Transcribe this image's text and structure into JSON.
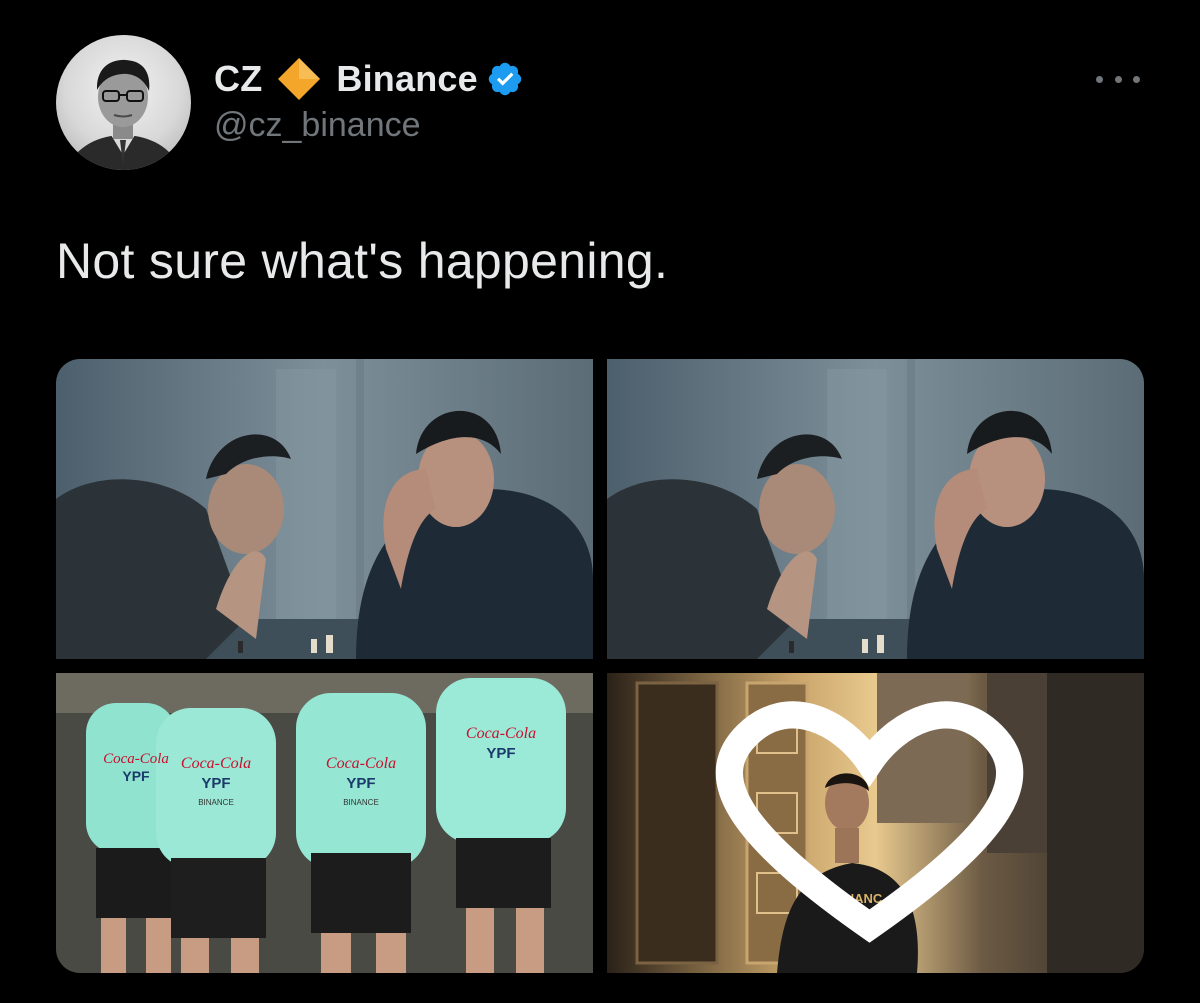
{
  "author": {
    "name_part1": "CZ",
    "name_part2": "Binance",
    "handle": "@cz_binance",
    "avatar_icon": "avatar-photo",
    "name_emoji": "orange-diamond-icon",
    "verified_icon": "verified-badge-icon"
  },
  "tweet": {
    "text": "Not sure what's happening."
  },
  "menu": {
    "more_icon": "more-options-icon"
  },
  "media": {
    "images": [
      {
        "description_icon": "chess-match-image"
      },
      {
        "description_icon": "chess-match-image"
      },
      {
        "description_icon": "team-training-image"
      },
      {
        "description_icon": "player-in-doorway-image"
      }
    ],
    "jersey_sponsor_1": "Coca-Cola",
    "jersey_sponsor_2": "YPF",
    "jersey_sponsor_3": "BINANCE",
    "shirt_text": "BINANC"
  },
  "colors": {
    "background": "#000000",
    "primary_text": "#e7e9ea",
    "secondary_text": "#71767b",
    "verified_blue": "#1d9bf0",
    "diamond_orange": "#f4a62a"
  }
}
